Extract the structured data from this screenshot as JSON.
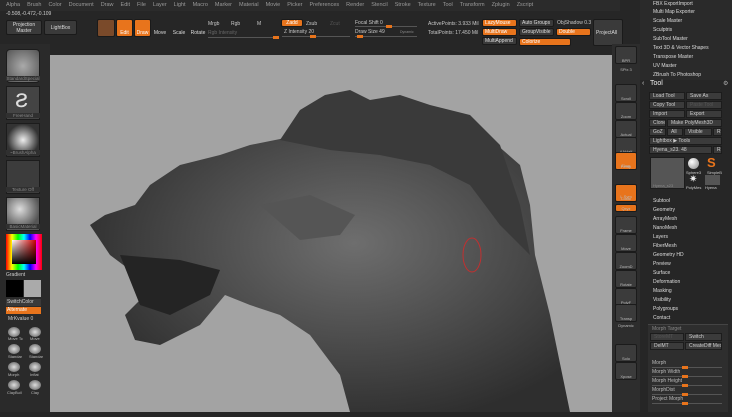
{
  "menu": [
    "Alpha",
    "Brush",
    "Color",
    "Document",
    "Draw",
    "Edit",
    "File",
    "Layer",
    "Light",
    "Macro",
    "Marker",
    "Material",
    "Movie",
    "Picker",
    "Preferences",
    "Render",
    "Stencil",
    "Stroke",
    "Texture",
    "Tool",
    "Transform",
    "Zplugin",
    "Zscript"
  ],
  "coords": "-0.508,-0.472,-0.109",
  "toolbar": {
    "projection_master": "Projection Master",
    "lightbox": "LightBox",
    "edit": "Edit",
    "draw": "Draw",
    "move": "Move",
    "scale": "Scale",
    "rotate": "Rotate",
    "mrgb": "Mrgb",
    "rgb": "Rgb",
    "m": "M",
    "rgb_intensity": "Rgb Intensity",
    "zadd": "Zadd",
    "zsub": "Zsub",
    "zcut": "Zcut",
    "z_intensity": "Z Intensity 20",
    "focal_shift": "Focal Shift 0",
    "draw_size": "Draw Size 49",
    "dynamic": "Dynamic",
    "active_points": "ActivePoints: 3.933 Mil",
    "total_points": "TotalPoints: 17.450 Mil",
    "lazymouse": "LazyMouse",
    "multidraw": "MultiDraw",
    "multiappend": "MultiAppend",
    "auto_groups": "Auto Groups",
    "group_visible": "GroupVisible",
    "colorize": "Colorize",
    "objshadow": "ObjShadow 0.3",
    "double": "Double",
    "projectall": "ProjectAll",
    "z_intensity_value": 20,
    "draw_size_value": 49
  },
  "plugins": [
    "FBX ExportImport",
    "Multi Map Exporter",
    "Scale Master",
    "Sculptris",
    "SubTool Master",
    "Text 3D & Vector Shapes",
    "Transpose Master",
    "UV Master",
    "ZBrush To Photoshop"
  ],
  "tool": {
    "title": "Tool",
    "load": "Load Tool",
    "save_as": "Save As",
    "copy": "Copy Tool",
    "paste": "Paste Tool",
    "import": "Import",
    "export": "Export",
    "clone": "Clone",
    "make_polymesh": "Make PolyMesh3D",
    "goz": "GoZ",
    "all": "All",
    "visible": "Visible",
    "r": "R",
    "lightbox_tools": "Lightbox ▶ Tools",
    "current": "Hyena_s23. 48",
    "thumbs": [
      "Hyena_s23",
      "Sphere3",
      "SimpleB",
      "PolyMes",
      "Hyena"
    ],
    "sections": [
      "Subtool",
      "Geometry",
      "ArrayMesh",
      "NanoMesh",
      "Layers",
      "FiberMesh",
      "Geometry HD",
      "Preview",
      "Surface",
      "Deformation",
      "Masking",
      "Visibility",
      "Polygroups",
      "Contact"
    ],
    "morph_target": "Morph Target",
    "storemt": "StoreMT",
    "switch": "Switch",
    "delmt": "DelMT",
    "create_diff": "CreateDiff Mesh",
    "sliders": [
      "Morph",
      "Morph Width",
      "Morph Height",
      "MorphDist",
      "Project Morph"
    ]
  },
  "left": {
    "brush": "StandardSpecial",
    "stroke": "FreeHand",
    "alpha": "~BrushAlpha",
    "texture": "Texture Off",
    "material": "BasicMaterial",
    "gradient": "Gradient",
    "switch_color": "SwitchColor",
    "alternate": "Alternate",
    "mrgb_value": "MrKvalue 0",
    "brushes": [
      "Move Tc",
      "Move",
      "Standar",
      "Standar",
      "Morph",
      "Inflat",
      "ClayBuil",
      "Clay"
    ]
  },
  "right_toolbar": [
    "BPR",
    "SPix 3",
    "Scroll",
    "Zoom",
    "Actual",
    "AAHalf",
    "Persp",
    "Floor",
    "Local",
    "L.Sym",
    "Qxyz",
    "Frame",
    "Move",
    "ZoomD",
    "Rotate",
    "PolyF",
    "Transp",
    "Dynamic",
    "Solo",
    "Xpose"
  ],
  "accent": "#e8741c"
}
